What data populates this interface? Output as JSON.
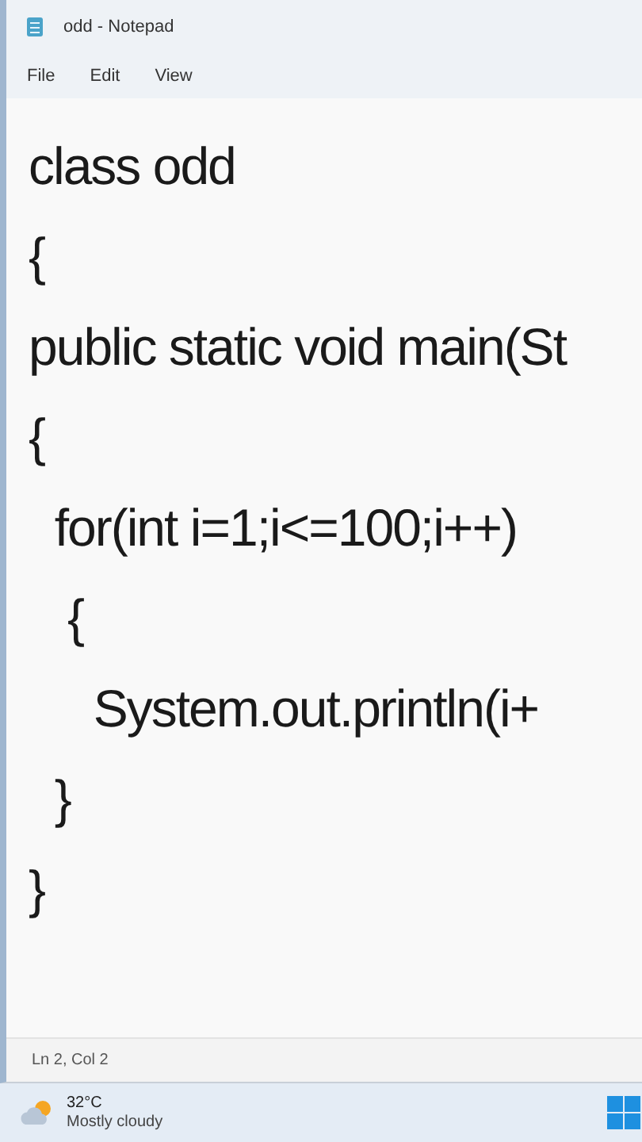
{
  "window": {
    "title": "odd - Notepad"
  },
  "menu": [
    "File",
    "Edit",
    "View"
  ],
  "editor": {
    "lines": [
      "class odd",
      "{",
      "public static void main(St",
      "{",
      "  for(int i=1;i<=100;i++)",
      "   {",
      "     System.out.println(i+",
      "  }",
      "}"
    ]
  },
  "status_bar": {
    "position": "Ln 2, Col 2"
  },
  "taskbar": {
    "weather": {
      "temperature": "32°C",
      "condition": "Mostly cloudy"
    }
  }
}
